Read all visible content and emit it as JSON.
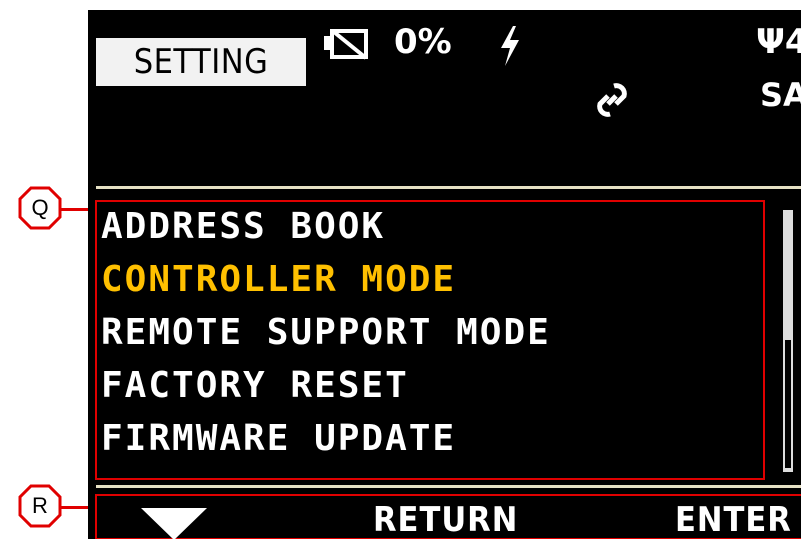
{
  "header": {
    "title": "SETTING",
    "battery_percent": "0%",
    "signal_text": "Ψ4",
    "sa_text": "SA"
  },
  "menu": {
    "items": [
      {
        "label": "ADDRESS BOOK",
        "color": "#ffffff"
      },
      {
        "label": "CONTROLLER MODE",
        "color": "#ffc000"
      },
      {
        "label": "REMOTE SUPPORT MODE",
        "color": "#ffffff"
      },
      {
        "label": "FACTORY RESET",
        "color": "#ffffff"
      },
      {
        "label": "FIRMWARE UPDATE",
        "color": "#ffffff"
      }
    ],
    "selected_index": 1
  },
  "footer": {
    "return_label": "RETURN",
    "enter_label": "ENTER"
  },
  "callouts": {
    "q": "Q",
    "r": "R"
  },
  "colors": {
    "highlight": "#ffc000",
    "callout_red": "#e00000",
    "divider": "#e6e1c4"
  },
  "icons": {
    "battery": "battery-empty-icon",
    "charging": "lightning-icon",
    "link": "link-icon",
    "down": "triangle-down-icon"
  }
}
